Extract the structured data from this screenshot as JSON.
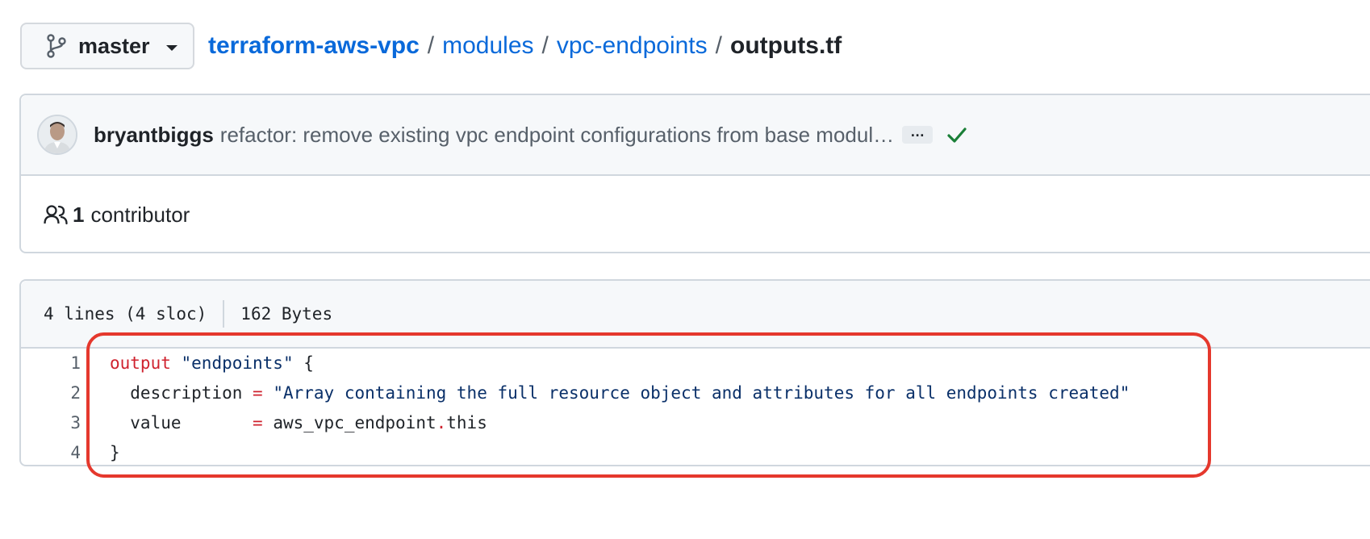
{
  "branch": {
    "name": "master",
    "icon": "git-branch-icon"
  },
  "breadcrumb": {
    "repo": "terraform-aws-vpc",
    "path": [
      "modules",
      "vpc-endpoints"
    ],
    "separator": "/",
    "current": "outputs.tf"
  },
  "commit": {
    "author": "bryantbiggs",
    "message": "refactor: remove existing vpc endpoint configurations from base modul…",
    "ellipsis": "…",
    "status": "check-icon",
    "status_color": "#1a7f37"
  },
  "contributors": {
    "count": "1",
    "label": "contributor",
    "icon": "people-icon"
  },
  "file": {
    "lines_info": "4 lines (4 sloc)",
    "size": "162 Bytes"
  },
  "code": {
    "lines": [
      {
        "num": "1",
        "tokens": [
          {
            "t": "output",
            "k": "kw"
          },
          {
            "t": " ",
            "k": ""
          },
          {
            "t": "\"endpoints\"",
            "k": "str"
          },
          {
            "t": " {",
            "k": ""
          }
        ]
      },
      {
        "num": "2",
        "tokens": [
          {
            "t": "  description ",
            "k": ""
          },
          {
            "t": "=",
            "k": "op"
          },
          {
            "t": " ",
            "k": ""
          },
          {
            "t": "\"Array containing the full resource object and attributes for all endpoints created\"",
            "k": "str"
          }
        ]
      },
      {
        "num": "3",
        "tokens": [
          {
            "t": "  value       ",
            "k": ""
          },
          {
            "t": "=",
            "k": "op"
          },
          {
            "t": " aws_vpc_endpoint",
            "k": ""
          },
          {
            "t": ".",
            "k": "op"
          },
          {
            "t": "this",
            "k": ""
          }
        ]
      },
      {
        "num": "4",
        "tokens": [
          {
            "t": "}",
            "k": ""
          }
        ]
      }
    ]
  },
  "colors": {
    "link": "#0969da",
    "highlight": "#e5382d"
  }
}
